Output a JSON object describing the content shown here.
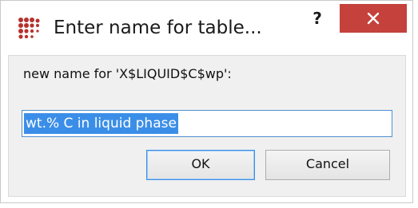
{
  "window": {
    "title": "Enter name for table...",
    "help_label": "?",
    "app_icon": "dots-logo-icon",
    "close_icon": "close-icon",
    "accent_close": "#c4413c"
  },
  "dialog": {
    "prompt": "new name for 'X$LIQUID$C$wp':",
    "input_value": "wt.% C in liquid phase",
    "selection_color": "#3b8ee8"
  },
  "buttons": {
    "ok_label": "OK",
    "cancel_label": "Cancel"
  }
}
